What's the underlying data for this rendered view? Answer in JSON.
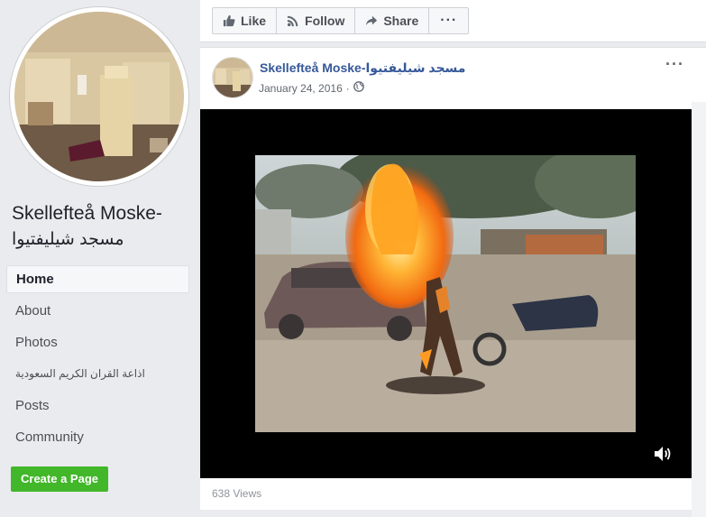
{
  "sidebar": {
    "page_name": "Skellefteå Moske-",
    "page_name_ar": "مسجد شيليفتيوا",
    "nav": [
      {
        "label": "Home"
      },
      {
        "label": "About"
      },
      {
        "label": "Photos"
      },
      {
        "label": "اذاعة القران الكريم السعودية"
      },
      {
        "label": "Posts"
      },
      {
        "label": "Community"
      }
    ],
    "create_page": "Create a Page"
  },
  "actions": {
    "like": "Like",
    "follow": "Follow",
    "share": "Share",
    "more": "···"
  },
  "post": {
    "author": "Skellefteå Moske-مسجد شيليفتيوا",
    "date": "January 24, 2016",
    "separator": "·",
    "menu": "···",
    "views": "638 Views"
  },
  "icons": [
    "thumbs-up-icon",
    "rss-icon",
    "share-arrow-icon",
    "globe-icon",
    "volume-icon"
  ],
  "colors": {
    "link": "#365899",
    "create_button": "#42b72a",
    "background": "#e9ebee"
  }
}
